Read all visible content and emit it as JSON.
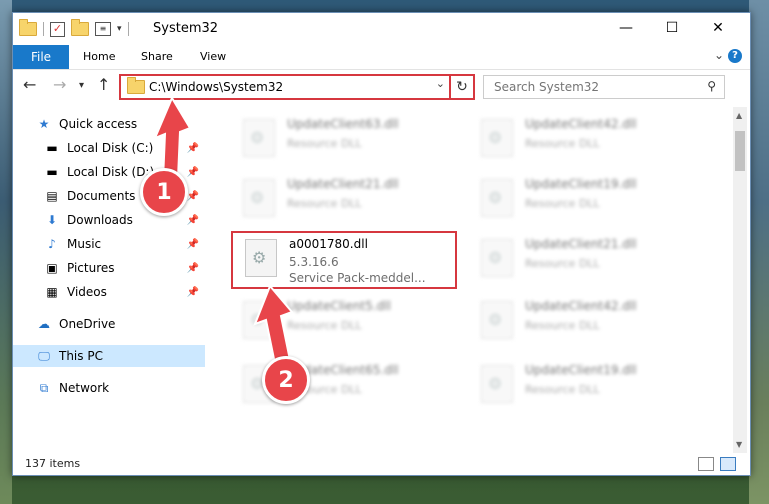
{
  "window": {
    "title": "System32"
  },
  "ribbon": {
    "tabs": [
      "File",
      "Home",
      "Share",
      "View"
    ]
  },
  "nav": {
    "address": "C:\\Windows\\System32",
    "search_placeholder": "Search System32"
  },
  "sidebar": {
    "items": [
      {
        "label": "Quick access",
        "icon": "star-icon"
      },
      {
        "label": "Local Disk (C:)",
        "icon": "drive-icon",
        "pinned": true
      },
      {
        "label": "Local Disk (D:)",
        "icon": "drive-icon",
        "pinned": true
      },
      {
        "label": "Documents",
        "icon": "documents-icon",
        "pinned": true
      },
      {
        "label": "Downloads",
        "icon": "download-icon",
        "pinned": true
      },
      {
        "label": "Music",
        "icon": "music-icon",
        "pinned": true
      },
      {
        "label": "Pictures",
        "icon": "pictures-icon",
        "pinned": true
      },
      {
        "label": "Videos",
        "icon": "videos-icon",
        "pinned": true
      },
      {
        "label": "OneDrive",
        "icon": "cloud-icon"
      },
      {
        "label": "This PC",
        "icon": "computer-icon",
        "selected": true
      },
      {
        "label": "Network",
        "icon": "network-icon"
      }
    ]
  },
  "files": {
    "left": [
      {
        "name": "UpdateClient63.dll",
        "type": "Resource DLL"
      },
      {
        "name": "UpdateClient21.dll",
        "type": "Resource DLL"
      },
      {
        "name": "a0001780.dll",
        "type": "5.3.16.6",
        "desc": "Service Pack-meddel..."
      },
      {
        "name": "UpdateClient5.dll",
        "type": "Resource DLL"
      },
      {
        "name": "UpdateClient65.dll",
        "type": "Resource DLL"
      }
    ],
    "right": [
      {
        "name": "UpdateClient42.dll",
        "type": "Resource DLL"
      },
      {
        "name": "UpdateClient19.dll",
        "type": "Resource DLL"
      },
      {
        "name": "UpdateClient21.dll",
        "type": "Resource DLL"
      },
      {
        "name": "UpdateClient42.dll",
        "type": "Resource DLL"
      },
      {
        "name": "UpdateClient19.dll",
        "type": "Resource DLL"
      }
    ]
  },
  "status": {
    "count": "137 items"
  },
  "annotations": {
    "step1": "1",
    "step2": "2",
    "color": "#e8454a"
  }
}
